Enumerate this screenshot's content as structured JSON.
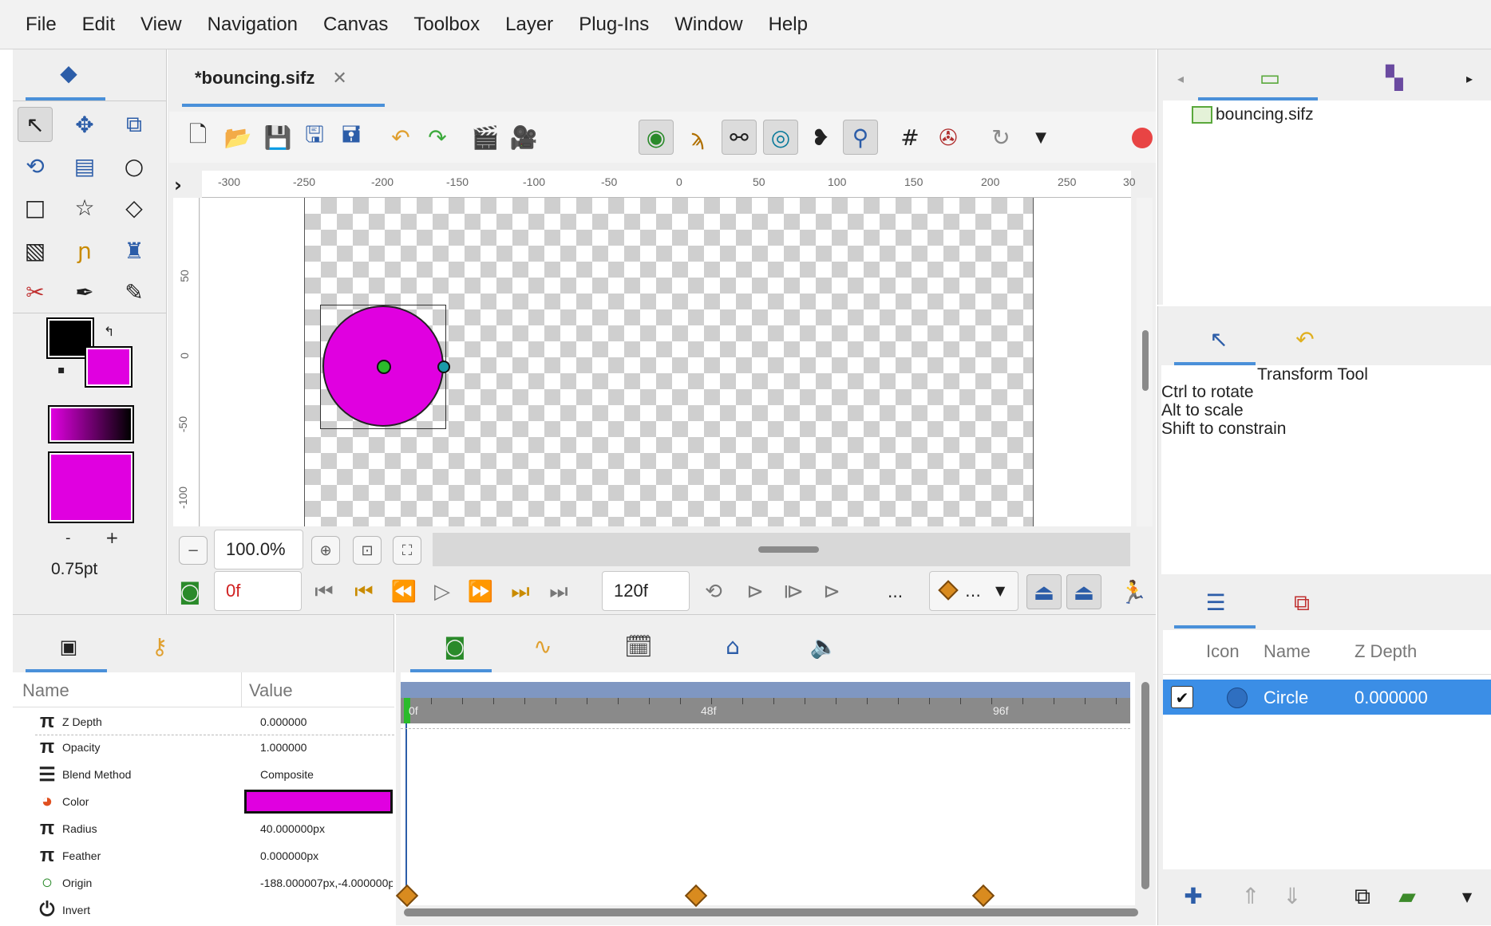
{
  "menu": [
    "File",
    "Edit",
    "View",
    "Navigation",
    "Canvas",
    "Toolbox",
    "Layer",
    "Plug-Ins",
    "Window",
    "Help"
  ],
  "document": {
    "tab_title": "*bouncing.sifz"
  },
  "canvas": {
    "zoom": "100.0%",
    "current_frame": "0f",
    "end_frame": "120f",
    "ruler_top": [
      "-300",
      "-250",
      "-200",
      "-150",
      "-100",
      "-50",
      "0",
      "50",
      "100",
      "150",
      "200",
      "250",
      "30"
    ],
    "ruler_left": [
      "50",
      "0",
      "-50",
      "-100"
    ],
    "more": "..."
  },
  "toolbox": {
    "brush_size": "0.75pt",
    "size_minus": "-",
    "size_plus": "+"
  },
  "colors": {
    "outline": "#000000",
    "fill": "#e000e0",
    "accent": "#4a90d9",
    "selection": "#3b8ee6"
  },
  "library": {
    "root_item": "bouncing.sifz"
  },
  "tool_options": {
    "title": "Transform Tool",
    "hints": [
      "Ctrl to rotate",
      "Alt to scale",
      "Shift to constrain"
    ]
  },
  "params": {
    "header_name": "Name",
    "header_value": "Value",
    "rows": [
      {
        "icon": "π",
        "name": "Z Depth",
        "value": "0.000000"
      },
      {
        "icon": "π",
        "name": "Opacity",
        "value": "1.000000"
      },
      {
        "icon": "☰",
        "name": "Blend Method",
        "value": "Composite"
      },
      {
        "icon": "◕",
        "name": "Color",
        "value": ""
      },
      {
        "icon": "π",
        "name": "Radius",
        "value": "40.000000px"
      },
      {
        "icon": "π",
        "name": "Feather",
        "value": "0.000000px"
      },
      {
        "icon": "○",
        "name": "Origin",
        "value": "-188.000007px,-4.000000p"
      },
      {
        "icon": "⏻",
        "name": "Invert",
        "value": ""
      }
    ]
  },
  "timeline": {
    "marks": [
      "0f",
      "48f",
      "96f"
    ]
  },
  "layers": {
    "headers": [
      "Icon",
      "Name",
      "Z Depth"
    ],
    "rows": [
      {
        "name": "Circle",
        "zdepth": "0.000000",
        "checked": "✔"
      }
    ]
  }
}
